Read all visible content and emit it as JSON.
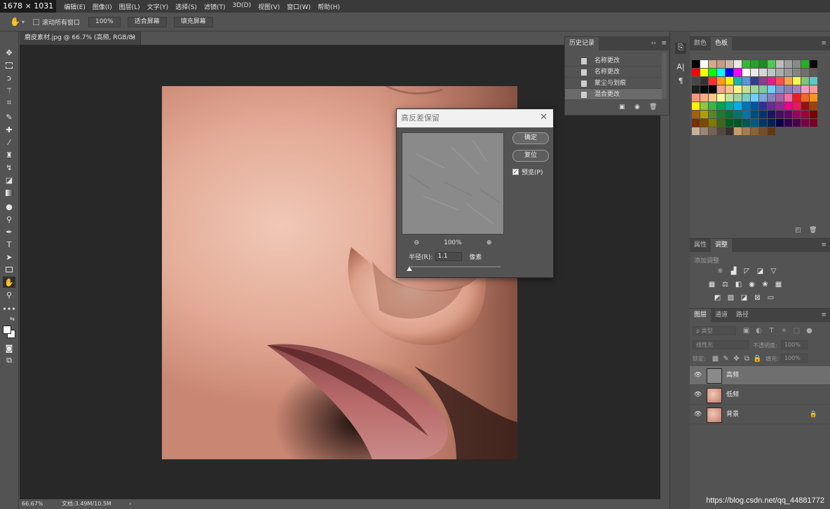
{
  "dims_label": "1678 × 1031",
  "menu": [
    "编辑(E)",
    "图像(I)",
    "图层(L)",
    "文字(Y)",
    "选择(S)",
    "滤镜(T)",
    "3D(D)",
    "视图(V)",
    "窗口(W)",
    "帮助(H)"
  ],
  "options": {
    "scroll_all_label": "滚动所有窗口",
    "zoom_btn": "100%",
    "fit_screen": "适合屏幕",
    "fill_screen": "填充屏幕"
  },
  "document": {
    "tab_title": "磨皮素材.jpg @ 66.7% (高频, RGB/8) *",
    "close_glyph": "×",
    "zoom": "66.67%",
    "doc_info": "文档:3.49M/10.5M",
    "status_arrow": "›"
  },
  "history": {
    "title": "历史记录",
    "items": [
      {
        "label": "名称更改",
        "selected": false
      },
      {
        "label": "名称更改",
        "selected": false
      },
      {
        "label": "蒙尘与划痕",
        "selected": false
      },
      {
        "label": "混合更改",
        "selected": true
      }
    ]
  },
  "swatches": {
    "tab_color": "颜色",
    "tab_swatches": "色板",
    "colors": [
      "#000000",
      "#ffffff",
      "#d2a88c",
      "#c89a86",
      "#c8b8a8",
      "#e8e8e8",
      "#3cb43c",
      "#28a028",
      "#1e8c1e",
      "#50c850",
      "#bcbcbc",
      "#a0a0a0",
      "#8a8a8a",
      "#1eb41e",
      "#0a0a0a",
      "#ff0000",
      "#ffff00",
      "#00ff00",
      "#00ffff",
      "#0000ff",
      "#ff00ff",
      "#ffffff",
      "#ebebeb",
      "#d6d6d6",
      "#c2c2c2",
      "#adadad",
      "#999999",
      "#858585",
      "#707070",
      "#5c5c5c",
      "#474747",
      "#333333",
      "#ff3030",
      "#ff9b1e",
      "#fff200",
      "#14b4b4",
      "#5a96dc",
      "#323c96",
      "#8c3c96",
      "#e61e8c",
      "#ff5050",
      "#ffa050",
      "#fff550",
      "#78c878",
      "#5ac8c8",
      "#1e1e1e",
      "#0a0a0a",
      "#000000",
      "#f4a58a",
      "#f8c08c",
      "#fdf38c",
      "#c4df9b",
      "#a3d39c",
      "#82ca9c",
      "#6dcff6",
      "#8393ca",
      "#8781bd",
      "#a186be",
      "#f49ac1",
      "#f5989d",
      "#f7977a",
      "#fbad82",
      "#fdc68a",
      "#fff799",
      "#c4df9b",
      "#a3d39c",
      "#7accc8",
      "#6ecff6",
      "#7da7d9",
      "#8781bd",
      "#a864a8",
      "#f06eaa",
      "#ed1c24",
      "#f26522",
      "#f7941d",
      "#fff200",
      "#8dc63f",
      "#39b54a",
      "#00a651",
      "#00a99d",
      "#00aeef",
      "#0072bc",
      "#0054a6",
      "#2e3192",
      "#662d91",
      "#92278f",
      "#ec008c",
      "#ed145b",
      "#9e0b0f",
      "#a0410d",
      "#a36209",
      "#aba000",
      "#598527",
      "#197b30",
      "#007236",
      "#00746b",
      "#0076a3",
      "#004b80",
      "#003471",
      "#1b1464",
      "#440e62",
      "#630460",
      "#9e005d",
      "#9e0039",
      "#790000",
      "#7b2e00",
      "#7d4900",
      "#827b00",
      "#406618",
      "#005e20",
      "#005826",
      "#005952",
      "#005b7f",
      "#003663",
      "#002157",
      "#0d004c",
      "#32004b",
      "#4b0049",
      "#7b0046",
      "#7a0026",
      "#c7b299",
      "#998675",
      "#736357",
      "#534741",
      "#37302d",
      "#c69c6e",
      "#a67c52",
      "#8c6239",
      "#754c24",
      "#603913"
    ]
  },
  "adjustments": {
    "tab_props": "属性",
    "tab_adjust": "调整",
    "add_label": "添加调整"
  },
  "layers": {
    "tab_layers": "图层",
    "tab_channels": "通道",
    "tab_paths": "路径",
    "filter_kind": "ρ 类型",
    "blend_mode": "线性光",
    "opacity_label": "不透明度:",
    "opacity": "100%",
    "lock_label": "锁定:",
    "fill_label": "填充:",
    "fill": "100%",
    "items": [
      {
        "name": "高频",
        "selected": true,
        "locked": false,
        "thumb": "gray"
      },
      {
        "name": "低频",
        "selected": false,
        "locked": false,
        "thumb": "photo"
      },
      {
        "name": "背景",
        "selected": false,
        "locked": true,
        "thumb": "photo"
      }
    ]
  },
  "dialog": {
    "title": "高反差保留",
    "ok": "确定",
    "reset": "复位",
    "preview_label": "预览(P)",
    "preview_checked": true,
    "zoom": "100%",
    "radius_label": "半径(R):",
    "radius_value": "1.1",
    "radius_unit": "像素"
  },
  "watermark": "https://blog.csdn.net/qq_44881772"
}
